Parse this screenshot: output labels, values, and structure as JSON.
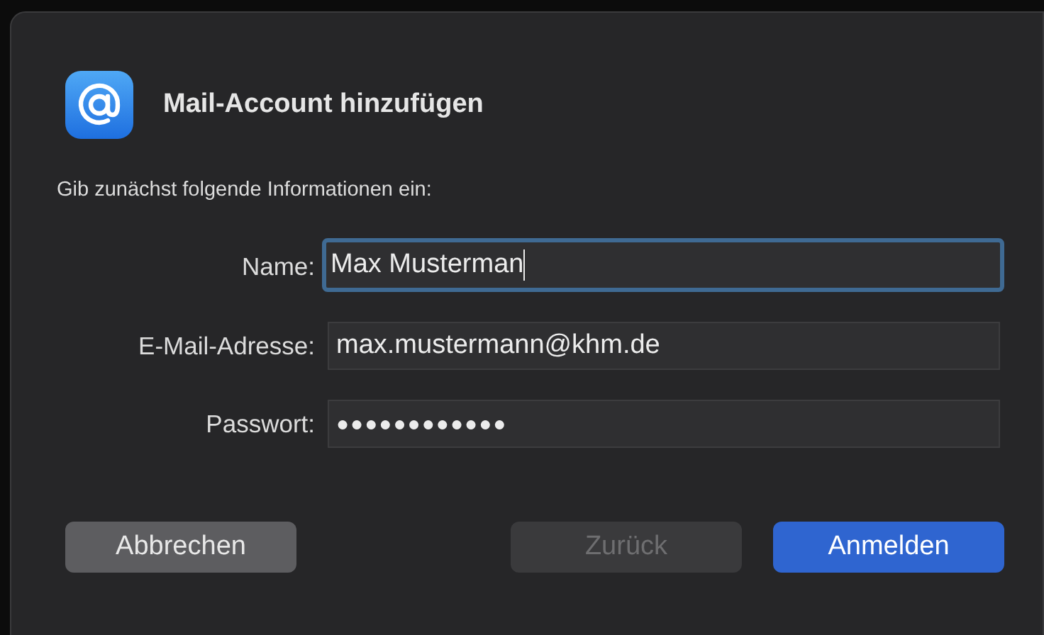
{
  "dialog": {
    "title": "Mail-Account hinzufügen",
    "subtitle": "Gib zunächst folgende Informationen ein:"
  },
  "fields": [
    {
      "label": "Name:",
      "value": "Max Musterman",
      "focused": true
    },
    {
      "label": "E-Mail-Adresse:",
      "value": "max.mustermann@khm.de",
      "focused": false
    },
    {
      "label": "Passwort:",
      "value": "●●●●●●●●●●●●",
      "focused": false
    }
  ],
  "buttons": [
    {
      "label": "Abbrechen",
      "kind": "normal",
      "disabled": false
    },
    {
      "label": "Zurück",
      "kind": "normal",
      "disabled": true
    },
    {
      "label": "Anmelden",
      "kind": "default",
      "disabled": false
    }
  ]
}
